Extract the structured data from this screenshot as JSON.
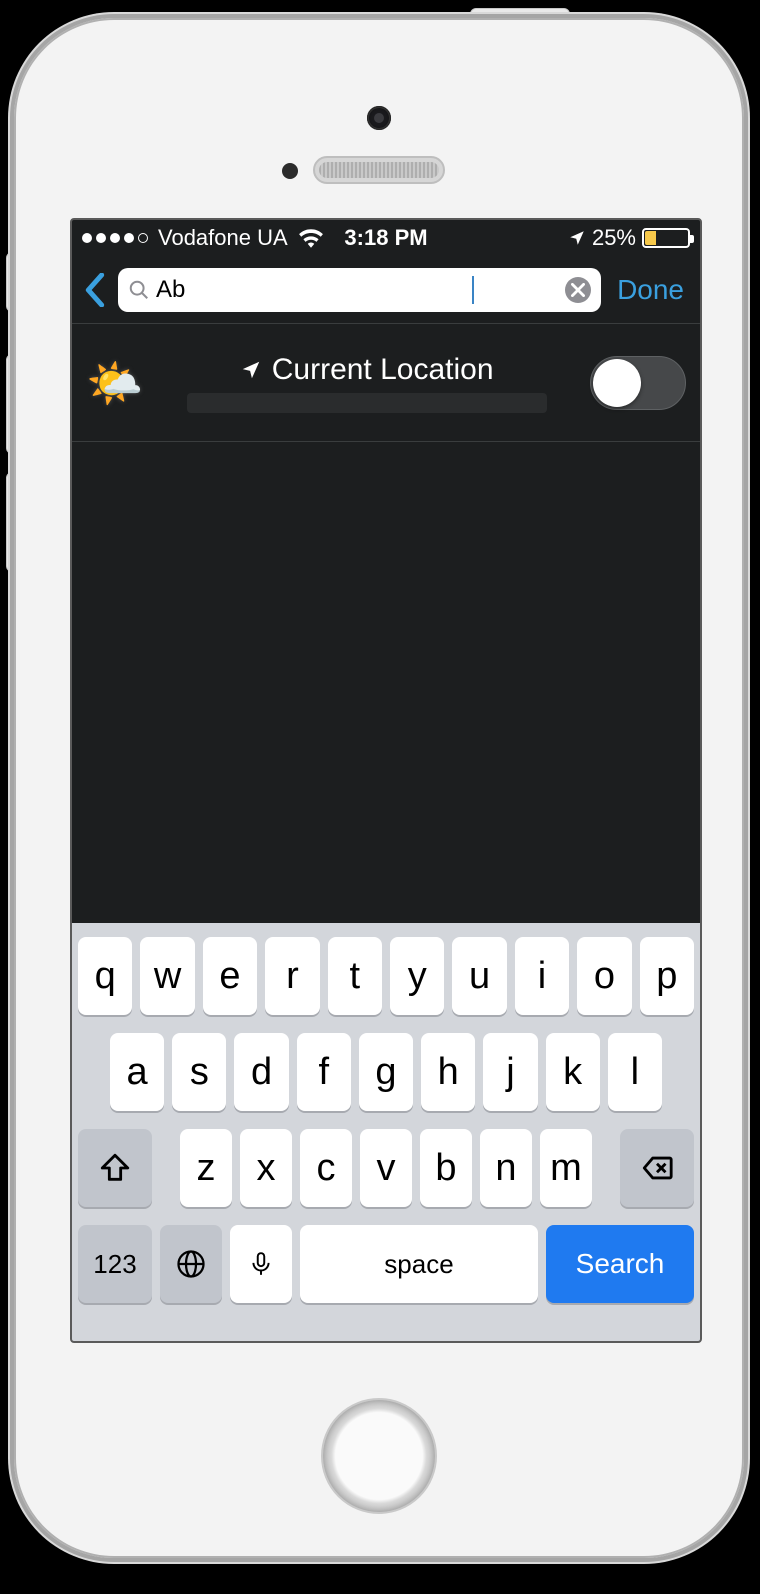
{
  "status": {
    "carrier": "Vodafone UA",
    "time": "3:18 PM",
    "battery_pct": "25%"
  },
  "header": {
    "search_value": "Ab",
    "done_label": "Done"
  },
  "current_location": {
    "label": "Current Location",
    "toggle_on": false
  },
  "keyboard": {
    "row1": [
      "q",
      "w",
      "e",
      "r",
      "t",
      "y",
      "u",
      "i",
      "o",
      "p"
    ],
    "row2": [
      "a",
      "s",
      "d",
      "f",
      "g",
      "h",
      "j",
      "k",
      "l"
    ],
    "row3": [
      "z",
      "x",
      "c",
      "v",
      "b",
      "n",
      "m"
    ],
    "numbers_label": "123",
    "space_label": "space",
    "action_label": "Search"
  }
}
